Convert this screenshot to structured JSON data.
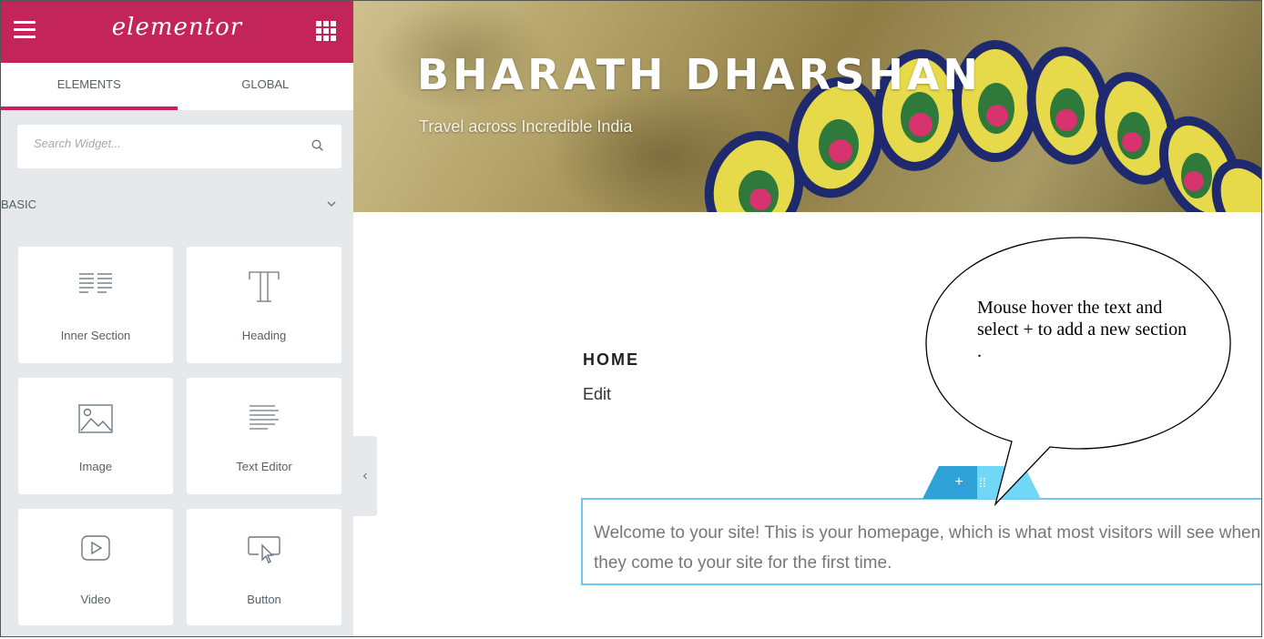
{
  "sidebar": {
    "logo": "elementor",
    "tabs": [
      {
        "label": "ELEMENTS",
        "active": true
      },
      {
        "label": "GLOBAL",
        "active": false
      }
    ],
    "search": {
      "placeholder": "Search Widget..."
    },
    "category": "BASIC",
    "widgets": [
      {
        "label": "Inner Section",
        "icon": "inner-section-icon"
      },
      {
        "label": "Heading",
        "icon": "heading-icon"
      },
      {
        "label": "Image",
        "icon": "image-icon"
      },
      {
        "label": "Text Editor",
        "icon": "text-editor-icon"
      },
      {
        "label": "Video",
        "icon": "video-icon"
      },
      {
        "label": "Button",
        "icon": "button-icon"
      }
    ],
    "collapse_glyph": "‹"
  },
  "header": {
    "site_title": "BHARATH DHARSHAN",
    "tagline": "Travel across Incredible India"
  },
  "main": {
    "page_heading": "HOME",
    "edit_link": "Edit",
    "section_handle": {
      "add": "+",
      "move": "⁞⁞",
      "delete": "×"
    },
    "text_editor": {
      "line1": "Welcome to your site! This is your homepage, which is what most visitors will see when",
      "line2": "they come to your site for the first time."
    }
  },
  "annotation": {
    "callout_text": "Mouse hover the text and select + to add a new section ."
  },
  "colors": {
    "brand": "#c3255b",
    "panel": "#e6e9ec",
    "handle_light": "#71d7f7",
    "handle_dark": "#2ea1d6",
    "editor_border": "#71c6ef"
  }
}
